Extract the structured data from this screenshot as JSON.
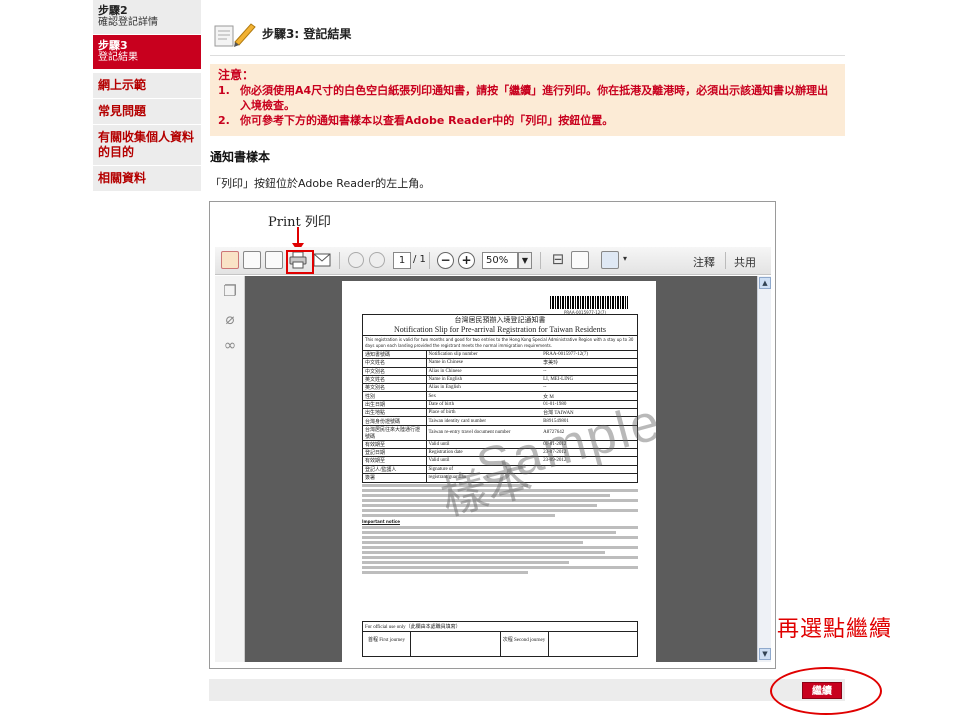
{
  "sidebar": {
    "steps": [
      {
        "title": "步驟2",
        "subtitle": "確認登記詳情"
      },
      {
        "title": "步驟3",
        "subtitle": "登記結果"
      }
    ],
    "links": [
      "網上示範",
      "常見問題",
      "有關收集個人資料的目的",
      "相關資料"
    ]
  },
  "step_header": {
    "title": "步驟3: 登記結果"
  },
  "notice": {
    "title": "注意：",
    "items": [
      {
        "num": "1.",
        "text": "你必須使用A4尺寸的白色空白紙張列印通知書，請按「繼續」進行列印。你在抵港及離港時，必須出示該通知書以辦理出入境檢查。"
      },
      {
        "num": "2.",
        "text": "你可參考下方的通知書樣本以查看Adobe Reader中的「列印」按鈕位置。"
      }
    ]
  },
  "sample": {
    "title": "通知書樣本",
    "desc": "「列印」按鈕位於Adobe Reader的左上角。",
    "print_label": "Print 列印"
  },
  "reader": {
    "page_num": "1",
    "page_total": "/ 1",
    "zoom": "50%",
    "comment": "注釋",
    "share": "共用"
  },
  "document": {
    "ref": "PRAA-0015977-12(7)",
    "title_cn": "台灣居民預辦入境登記通知書",
    "title_en": "Notification Slip for Pre-arrival Registration for Taiwan Residents",
    "intro": "This registration is valid for two months and good for two entries to the Hong Kong Special Administrative Region with a stay up to 30 days upon each landing provided the registrant meets the normal immigration requirements.",
    "rows": [
      [
        "通知書號碼",
        "Notification slip number",
        "PRAA-0015977-12(7)"
      ],
      [
        "中文姓名",
        "Name in Chinese",
        "李美玲"
      ],
      [
        "中文別名",
        "Alias in Chinese",
        "--"
      ],
      [
        "英文姓名",
        "Name in English",
        "LI, MEI-LING"
      ],
      [
        "英文別名",
        "Alias in English",
        "--"
      ],
      [
        "性別",
        "Sex",
        "女 M"
      ],
      [
        "出生日期",
        "Date of birth",
        "01-01-1980"
      ],
      [
        "出生地點",
        "Place of birth",
        "台灣 TAIWAN"
      ],
      [
        "台灣身份證號碼",
        "Taiwan identity card number",
        "B891549801"
      ],
      [
        "台灣居民往來大陸通行證號碼",
        "Taiwan re-entry travel document number",
        "A8727642"
      ],
      [
        "有效期至",
        "Valid until",
        "01-01-2012"
      ],
      [
        "登記日期",
        "Registration date",
        "23-07-2012"
      ],
      [
        "有效期至",
        "Valid until",
        "23-09-2012"
      ],
      [
        "登記人/監護人",
        "Signature of",
        ""
      ],
      [
        "簽署",
        "registrant/guardian",
        ""
      ]
    ],
    "notes_head": "Important notice",
    "official_head": "For official use only（此欄由本處職員填寫）",
    "first_journey": "首程 First journey",
    "second_journey": "次程 Second journey",
    "watermark_en": "Sample",
    "watermark_cn": "樣本"
  },
  "annotation": {
    "text": "再選點繼續"
  },
  "continue_button": {
    "label": "繼續"
  }
}
